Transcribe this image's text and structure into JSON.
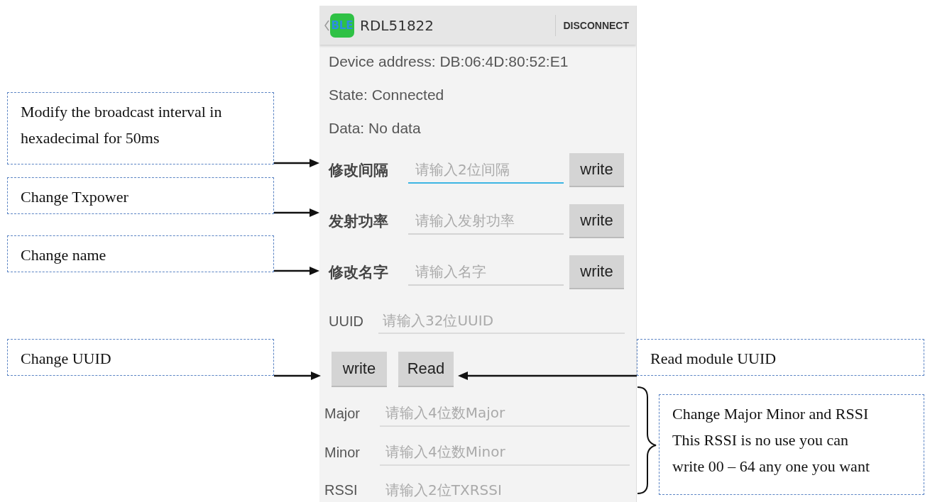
{
  "app_bar": {
    "logo": "BLE",
    "title": "RDL51822",
    "action": "DISCONNECT"
  },
  "info": [
    "Device address: DB:06:4D:80:52:E1",
    "State: Connected",
    "Data: No data"
  ],
  "settings": [
    {
      "label": "修改间隔",
      "placeholder": "请输入2位间隔",
      "focused": true,
      "button": "write"
    },
    {
      "label": "发射功率",
      "placeholder": "请输入发射功率",
      "focused": false,
      "button": "write"
    },
    {
      "label": "修改名字",
      "placeholder": "请输入名字",
      "focused": false,
      "button": "write"
    }
  ],
  "uuid_field": {
    "label": "UUID",
    "placeholder": "请输入32位UUID"
  },
  "uuid_buttons": [
    "write",
    "Read"
  ],
  "beacon_fields": [
    {
      "label": "Major",
      "placeholder": "请输入4位数Major"
    },
    {
      "label": "Minor",
      "placeholder": "请输入4位数Minor"
    },
    {
      "label": "RSSI",
      "placeholder": "请输入2位TXRSSI"
    }
  ],
  "annotations": [
    {
      "kind": "arrow",
      "lines": [
        "Modify the broadcast interval in",
        "hexadecimal for 50ms"
      ]
    },
    {
      "kind": "arrow",
      "lines": [
        "Change Txpower"
      ]
    },
    {
      "kind": "arrow",
      "lines": [
        "Change name"
      ]
    },
    {
      "kind": "arrow",
      "lines": [
        "Change UUID"
      ]
    },
    {
      "kind": "arrow",
      "lines": [
        "Read module UUID"
      ]
    },
    {
      "kind": "brace",
      "lines": [
        "Change Major Minor and RSSI",
        "This RSSI is no use you can",
        "write 00 – 64 any one you want"
      ]
    }
  ]
}
